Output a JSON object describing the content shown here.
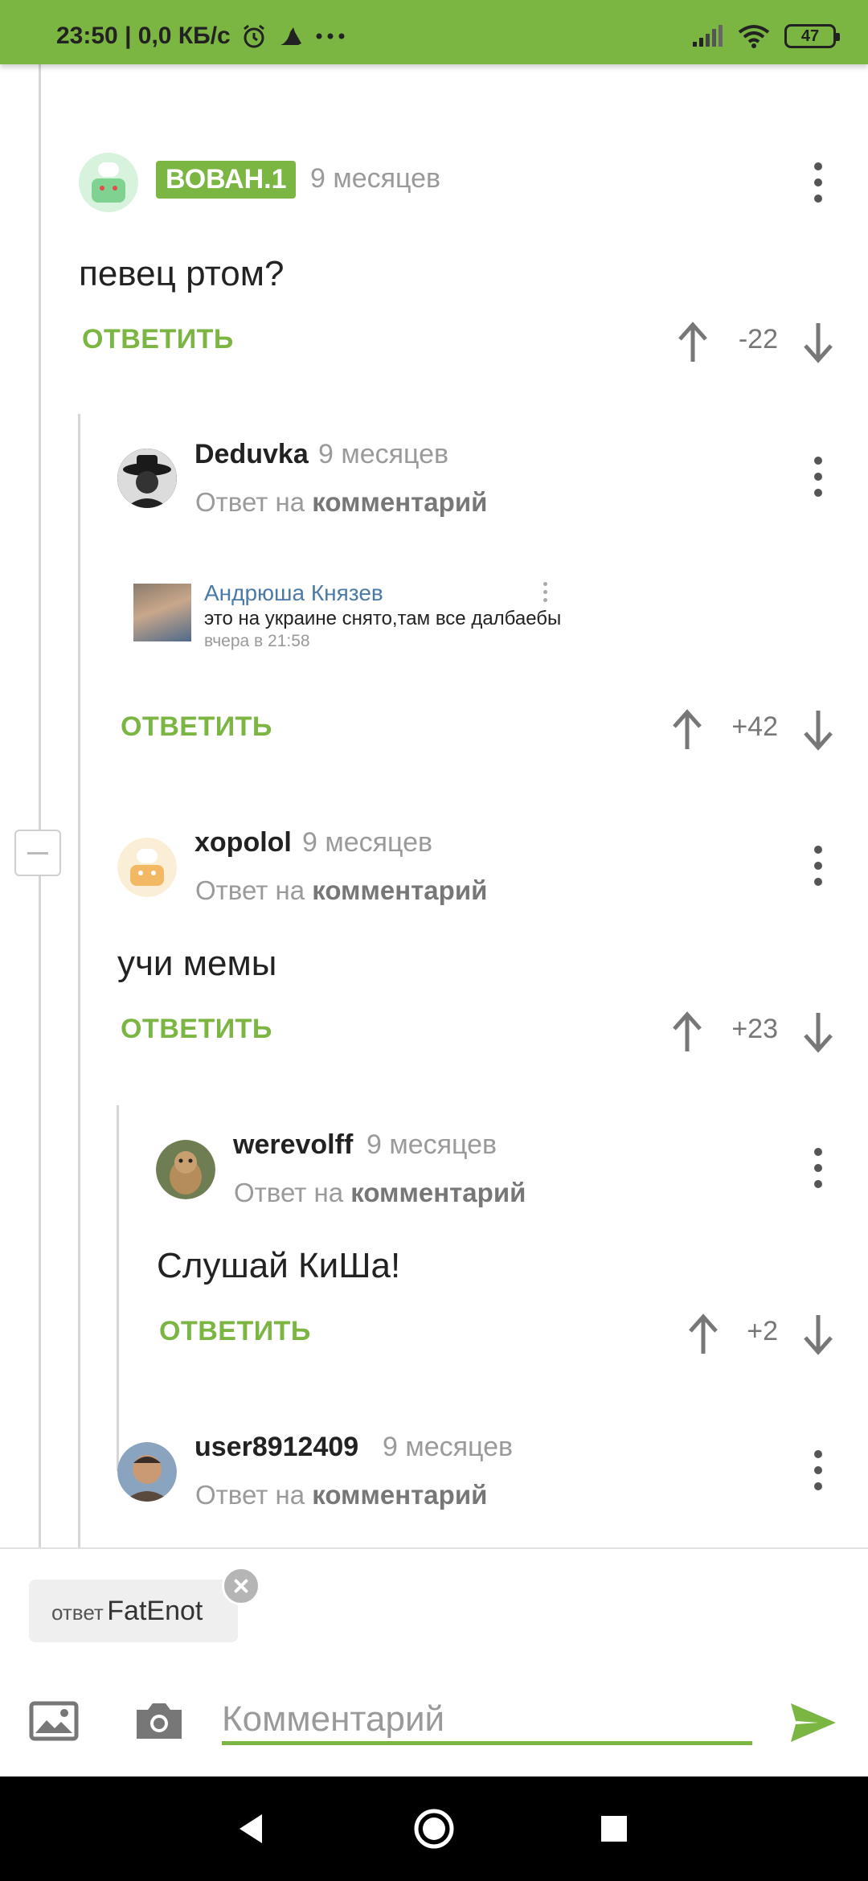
{
  "status_bar": {
    "time_speed": "23:50 | 0,0 КБ/с",
    "battery": "47"
  },
  "comments": [
    {
      "author": "ВОВАН.1",
      "time": "9 месяцев",
      "text": "певец ртом?",
      "reply_label": "ОТВЕТИТЬ",
      "score": "-22"
    },
    {
      "author": "Deduvka",
      "time": "9 месяцев",
      "reply_to_prefix": "Ответ на",
      "reply_to_link": "комментарий",
      "quote": {
        "name": "Андрюша Князев",
        "text": "это на украине снято,там все далбаебы",
        "time": "вчера в 21:58"
      },
      "reply_label": "ОТВЕТИТЬ",
      "score": "+42"
    },
    {
      "author": "xopolol",
      "time": "9 месяцев",
      "reply_to_prefix": "Ответ на",
      "reply_to_link": "комментарий",
      "text": "учи мемы",
      "reply_label": "ОТВЕТИТЬ",
      "score": "+23"
    },
    {
      "author": "werevolff",
      "time": "9 месяцев",
      "reply_to_prefix": "Ответ на",
      "reply_to_link": "комментарий",
      "text": "Слушай КиШа!",
      "reply_label": "ОТВЕТИТЬ",
      "score": "+2"
    },
    {
      "author": "user8912409",
      "time": "9 месяцев",
      "reply_to_prefix": "Ответ на",
      "reply_to_link": "комментарий"
    }
  ],
  "composer": {
    "reply_chip_label": "ответ",
    "reply_chip_name": "FatEnot",
    "placeholder": "Комментарий"
  },
  "colors": {
    "accent": "#7bb542",
    "muted": "#9a9a9a"
  }
}
